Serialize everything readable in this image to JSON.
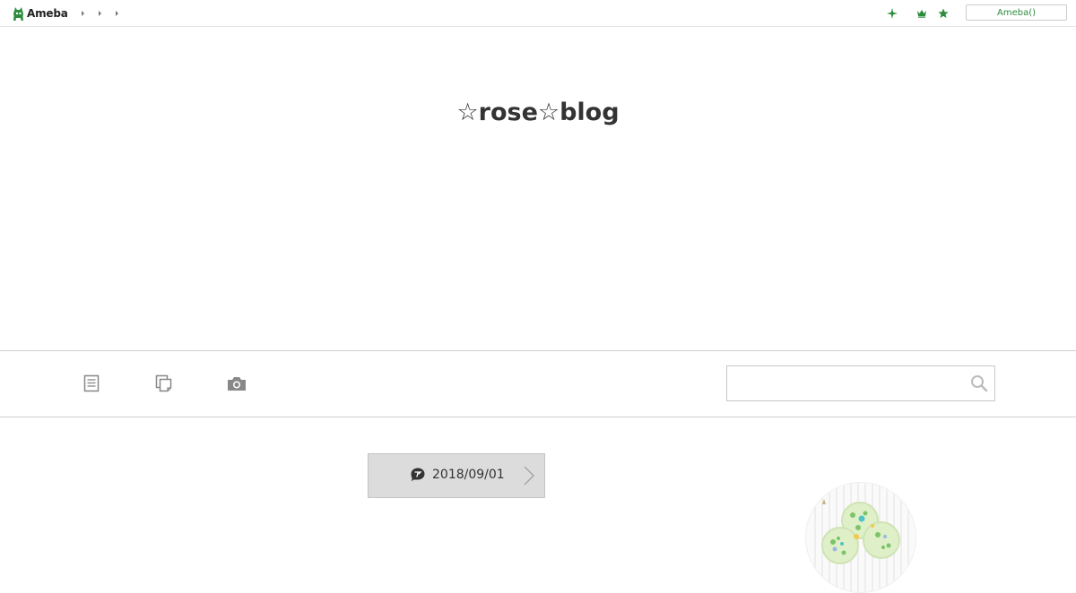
{
  "topbar": {
    "logo_text": "Ameba",
    "nav_arrows": [
      "arrow",
      "arrow",
      "arrow"
    ],
    "icons": [
      "sparkle-icon",
      "crown-icon",
      "star-icon"
    ],
    "login_label": "Ameba()"
  },
  "header": {
    "title": "☆rose☆blog"
  },
  "nav": {
    "items": [
      "entries-icon",
      "themes-icon",
      "photos-icon"
    ],
    "search_placeholder": "",
    "search_value": ""
  },
  "pager": {
    "date": "2018/09/01"
  },
  "colors": {
    "brand_green": "#2d8c3c",
    "pager_bg": "#dcdcdc",
    "icon_gray": "#888888"
  }
}
